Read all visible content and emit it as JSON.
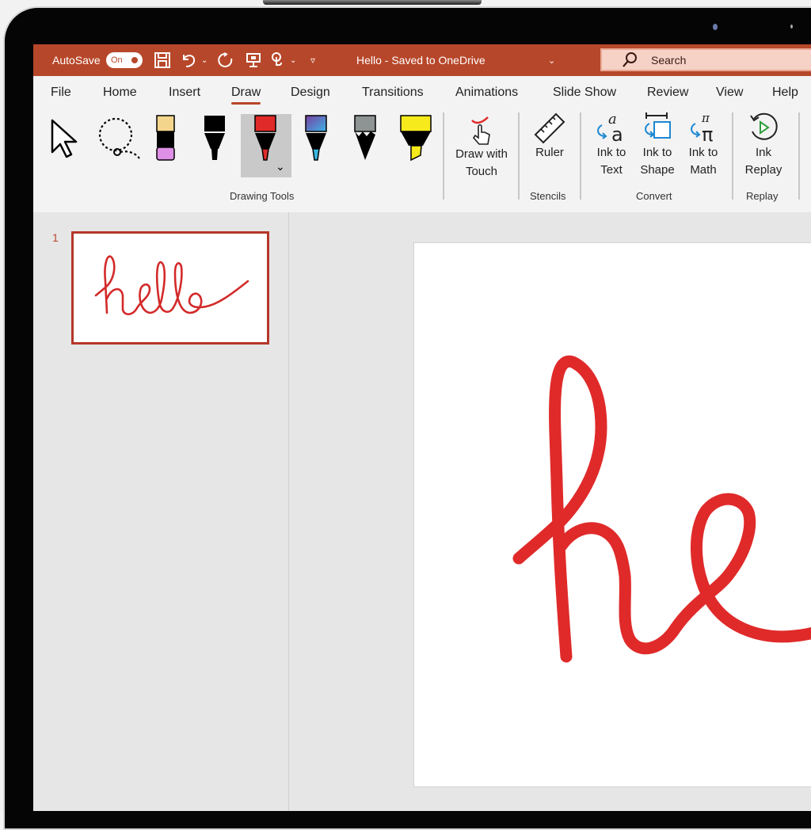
{
  "titlebar": {
    "autosave_label": "AutoSave",
    "autosave_state": "On",
    "quick_access": [
      "save-icon",
      "undo-icon",
      "undo-dropdown",
      "redo-icon",
      "present-icon",
      "touch-mode-icon",
      "touch-dropdown",
      "customize-qat-icon"
    ],
    "doc_title": "Hello - Saved to OneDrive",
    "search_placeholder": "Search",
    "accent_color": "#b7472a"
  },
  "tabs": [
    {
      "label": "File"
    },
    {
      "label": "Home"
    },
    {
      "label": "Insert"
    },
    {
      "label": "Draw",
      "active": true
    },
    {
      "label": "Design"
    },
    {
      "label": "Transitions"
    },
    {
      "label": "Animations"
    },
    {
      "label": "Slide Show"
    },
    {
      "label": "Review"
    },
    {
      "label": "View"
    },
    {
      "label": "Help"
    }
  ],
  "ribbon": {
    "groups": [
      {
        "label": "Drawing Tools",
        "tools": [
          "select-arrow-icon",
          "lasso-select-icon",
          "eraser-icon",
          "black-pen-icon",
          "red-pen-icon",
          "galaxy-pen-icon",
          "pencil-icon",
          "yellow-highlighter-icon"
        ]
      },
      {
        "label": "",
        "buttons": [
          {
            "label_line1": "Draw with",
            "label_line2": "Touch"
          }
        ]
      },
      {
        "label": "Stencils",
        "buttons": [
          {
            "label_line1": "Ruler"
          }
        ]
      },
      {
        "label": "Convert",
        "buttons": [
          {
            "label_line1": "Ink to",
            "label_line2": "Text"
          },
          {
            "label_line1": "Ink to",
            "label_line2": "Shape"
          },
          {
            "label_line1": "Ink to",
            "label_line2": "Math"
          }
        ]
      },
      {
        "label": "Replay",
        "buttons": [
          {
            "label_line1": "Ink",
            "label_line2": "Replay"
          }
        ]
      }
    ],
    "selected_pen_color": "#e02a2a"
  },
  "slides": {
    "thumbnails": [
      {
        "number": "1",
        "content": "hello"
      }
    ],
    "current_ink_text": "hello",
    "ink_color": "#e02a2a"
  }
}
